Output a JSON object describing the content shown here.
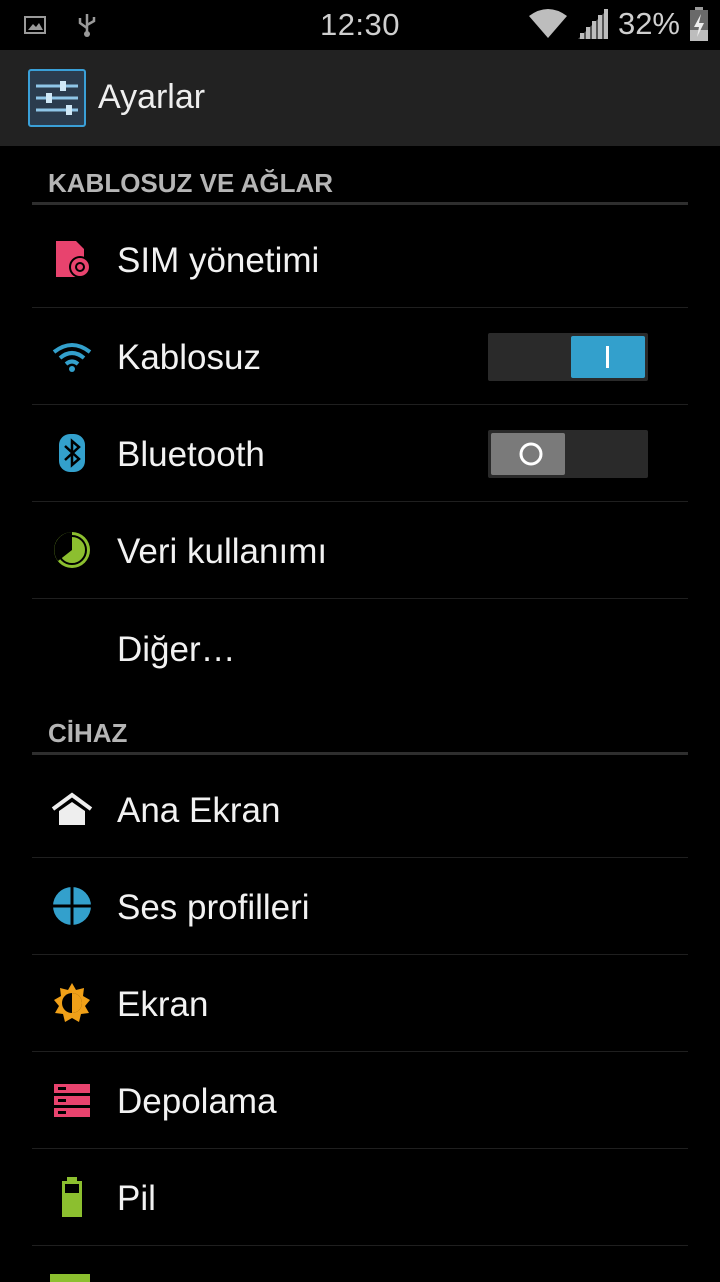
{
  "status_bar": {
    "time": "12:30",
    "battery_percent": "32%",
    "icons": [
      "image-notification-icon",
      "usb-icon",
      "wifi-signal-icon",
      "cell-signal-icon",
      "battery-charging-icon"
    ]
  },
  "action_bar": {
    "title": "Ayarlar",
    "icon": "settings-sliders-icon"
  },
  "sections": {
    "wireless": {
      "header": "KABLOSUZ VE AĞLAR",
      "items": [
        {
          "label": "SIM yönetimi",
          "icon": "sim-card-icon"
        },
        {
          "label": "Kablosuz",
          "icon": "wifi-icon",
          "toggle": "on"
        },
        {
          "label": "Bluetooth",
          "icon": "bluetooth-icon",
          "toggle": "off"
        },
        {
          "label": "Veri kullanımı",
          "icon": "data-usage-icon"
        },
        {
          "label": "Diğer…"
        }
      ]
    },
    "device": {
      "header": "CİHAZ",
      "items": [
        {
          "label": "Ana Ekran",
          "icon": "home-icon"
        },
        {
          "label": "Ses profilleri",
          "icon": "sound-profile-icon"
        },
        {
          "label": "Ekran",
          "icon": "brightness-icon"
        },
        {
          "label": "Depolama",
          "icon": "storage-icon"
        },
        {
          "label": "Pil",
          "icon": "battery-icon"
        }
      ]
    }
  },
  "colors": {
    "accent": "#33a0cc",
    "actionbar_bg": "#222222",
    "background": "#000000"
  }
}
